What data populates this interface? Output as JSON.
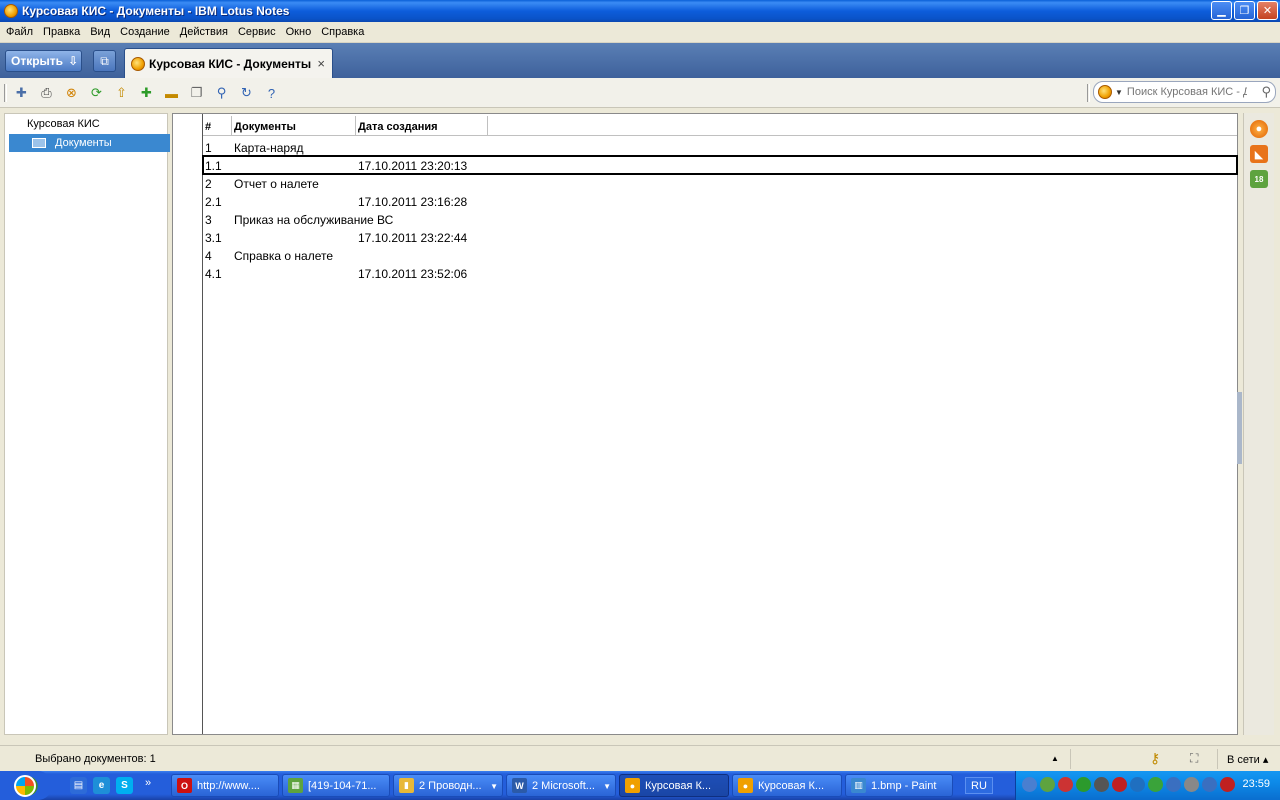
{
  "window": {
    "title": "Курсовая КИС - Документы - IBM Lotus Notes",
    "minimize_glyph": "▁",
    "maximize_glyph": "❐",
    "close_glyph": "✕"
  },
  "menu": [
    "Файл",
    "Правка",
    "Вид",
    "Создание",
    "Действия",
    "Сервис",
    "Окно",
    "Справка"
  ],
  "tabstrip": {
    "open_label": "Открыть",
    "open_arrow": "⇩",
    "copy_glyph": "⧉",
    "tab_label": "Курсовая КИС - Документы",
    "tab_close": "×"
  },
  "toolbar": {
    "icons": [
      {
        "name": "new-document-icon",
        "glyph": "✚",
        "cls": "new"
      },
      {
        "name": "print-icon",
        "glyph": "⎙",
        "cls": "print"
      },
      {
        "name": "stop-icon",
        "glyph": "⊗",
        "cls": "stop"
      },
      {
        "name": "refresh-green-icon",
        "glyph": "⟳",
        "cls": "green"
      },
      {
        "name": "up-arrow-icon",
        "glyph": "⇧",
        "cls": "gold"
      },
      {
        "name": "expand-all-icon",
        "glyph": "✚",
        "cls": "green"
      },
      {
        "name": "collapse-all-icon",
        "glyph": "▬",
        "cls": "gold"
      },
      {
        "name": "copy-icon",
        "glyph": "❐",
        "cls": "gray"
      },
      {
        "name": "find-icon",
        "glyph": "⚲",
        "cls": "blue"
      },
      {
        "name": "reload-icon",
        "glyph": "↻",
        "cls": "blue"
      },
      {
        "name": "help-icon",
        "glyph": "?",
        "cls": "blue"
      }
    ],
    "search_placeholder": "Поиск Курсовая КИС - Д",
    "search_drop": "▼",
    "search_glyph": "⚲"
  },
  "navigator": {
    "db_title": "Курсовая КИС",
    "items": [
      {
        "label": "Документы"
      }
    ]
  },
  "view": {
    "columns": [
      "#",
      "Документы",
      "Дата создания"
    ],
    "rows": [
      {
        "num": "1",
        "doc": "Карта-наряд",
        "date": "",
        "selected": false
      },
      {
        "num": "1.1",
        "doc": "",
        "date": "17.10.2011 23:20:13",
        "selected": true
      },
      {
        "num": "2",
        "doc": "Отчет о налете",
        "date": "",
        "selected": false
      },
      {
        "num": "2.1",
        "doc": "",
        "date": "17.10.2011 23:16:28",
        "selected": false
      },
      {
        "num": "3",
        "doc": "Приказ на обслуживание ВС",
        "date": "",
        "selected": false
      },
      {
        "num": "3.1",
        "doc": "",
        "date": "17.10.2011 23:22:44",
        "selected": false
      },
      {
        "num": "4",
        "doc": "Справка о налете",
        "date": "",
        "selected": false
      },
      {
        "num": "4.1",
        "doc": "",
        "date": "17.10.2011 23:52:06",
        "selected": false
      }
    ]
  },
  "right_panel": {
    "sametime_glyph": "●",
    "feeds_glyph": "◣",
    "calendar_glyph": "18"
  },
  "status": {
    "selected_text": "Выбрано документов: 1",
    "up_glyph": "▲",
    "key_glyph": "⚷",
    "location_glyph": "⛶",
    "online_text": "В сети ▴"
  },
  "taskbar": {
    "quick": [
      {
        "name": "show-desktop-icon",
        "glyph": "▤",
        "bg": "#2d6bd8"
      },
      {
        "name": "ie-icon",
        "glyph": "e",
        "bg": "#1e8fd8"
      },
      {
        "name": "skype-icon",
        "glyph": "S",
        "bg": "#00aff0"
      }
    ],
    "quick_more": "»",
    "tasks": [
      {
        "label": "http://www....",
        "glyph": "O",
        "bg": "#cc1010",
        "width": 108,
        "active": false,
        "drop": false
      },
      {
        "label": "[419-104-71...",
        "glyph": "▦",
        "bg": "#5ea33f",
        "width": 108,
        "active": false,
        "drop": false
      },
      {
        "label": "2 Проводн...",
        "glyph": "▮",
        "bg": "#e8b838",
        "width": 110,
        "active": false,
        "drop": true
      },
      {
        "label": "2 Microsoft...",
        "glyph": "W",
        "bg": "#2b5aa8",
        "width": 110,
        "active": false,
        "drop": true
      },
      {
        "label": "Курсовая К...",
        "glyph": "●",
        "bg": "#f0a000",
        "width": 110,
        "active": true,
        "drop": false
      },
      {
        "label": "Курсовая К...",
        "glyph": "●",
        "bg": "#f0a000",
        "width": 110,
        "active": false,
        "drop": false
      },
      {
        "label": "1.bmp - Paint",
        "glyph": "▥",
        "bg": "#3a88d0",
        "width": 108,
        "active": false,
        "drop": false
      }
    ],
    "lang": "RU",
    "tray": [
      {
        "name": "tray-people-icon",
        "bg": "#4a7fd0"
      },
      {
        "name": "tray-shield-icon",
        "bg": "#5ea33f"
      },
      {
        "name": "tray-network-icon",
        "bg": "#cc3333"
      },
      {
        "name": "tray-update-icon",
        "bg": "#2c9a2c"
      },
      {
        "name": "tray-media-icon",
        "bg": "#555555"
      },
      {
        "name": "tray-app-icon",
        "bg": "#c02020"
      },
      {
        "name": "tray-display-icon",
        "bg": "#1f6fc0"
      },
      {
        "name": "tray-signal-icon",
        "bg": "#3aa33a"
      },
      {
        "name": "tray-volume-icon",
        "bg": "#3a6fc0"
      },
      {
        "name": "tray-clock-icon",
        "bg": "#888888"
      },
      {
        "name": "tray-wifi-icon",
        "bg": "#3a6fc0"
      },
      {
        "name": "tray-usb-icon",
        "bg": "#c02020"
      }
    ],
    "clock": "23:59"
  }
}
